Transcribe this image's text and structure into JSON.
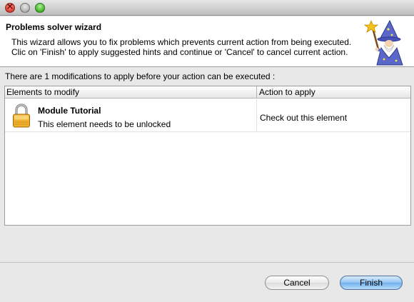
{
  "window": {
    "controls": [
      "close-icon",
      "minimize-icon",
      "maximize-icon"
    ]
  },
  "banner": {
    "title": "Problems solver wizard",
    "description_line1": "This wizard allows you to fix problems which prevents current action from being executed.",
    "description_line2": "Clic on 'Finish' to apply suggested hints and continue or 'Cancel' to cancel current action.",
    "image": "wizard-icon"
  },
  "info": "There are 1 modifications to apply before your action can be executed :",
  "table": {
    "columns": [
      "Elements to modify",
      "Action to apply"
    ],
    "rows": [
      {
        "icon": "lock-icon",
        "title": "Module Tutorial",
        "description": "This element needs to be unlocked",
        "action": "Check out this element"
      }
    ]
  },
  "buttons": {
    "cancel": "Cancel",
    "finish": "Finish"
  },
  "colors": {
    "finish_button": "#7db8ee",
    "banner_background": "#ffffff",
    "dialog_background": "#e8e8e8"
  }
}
